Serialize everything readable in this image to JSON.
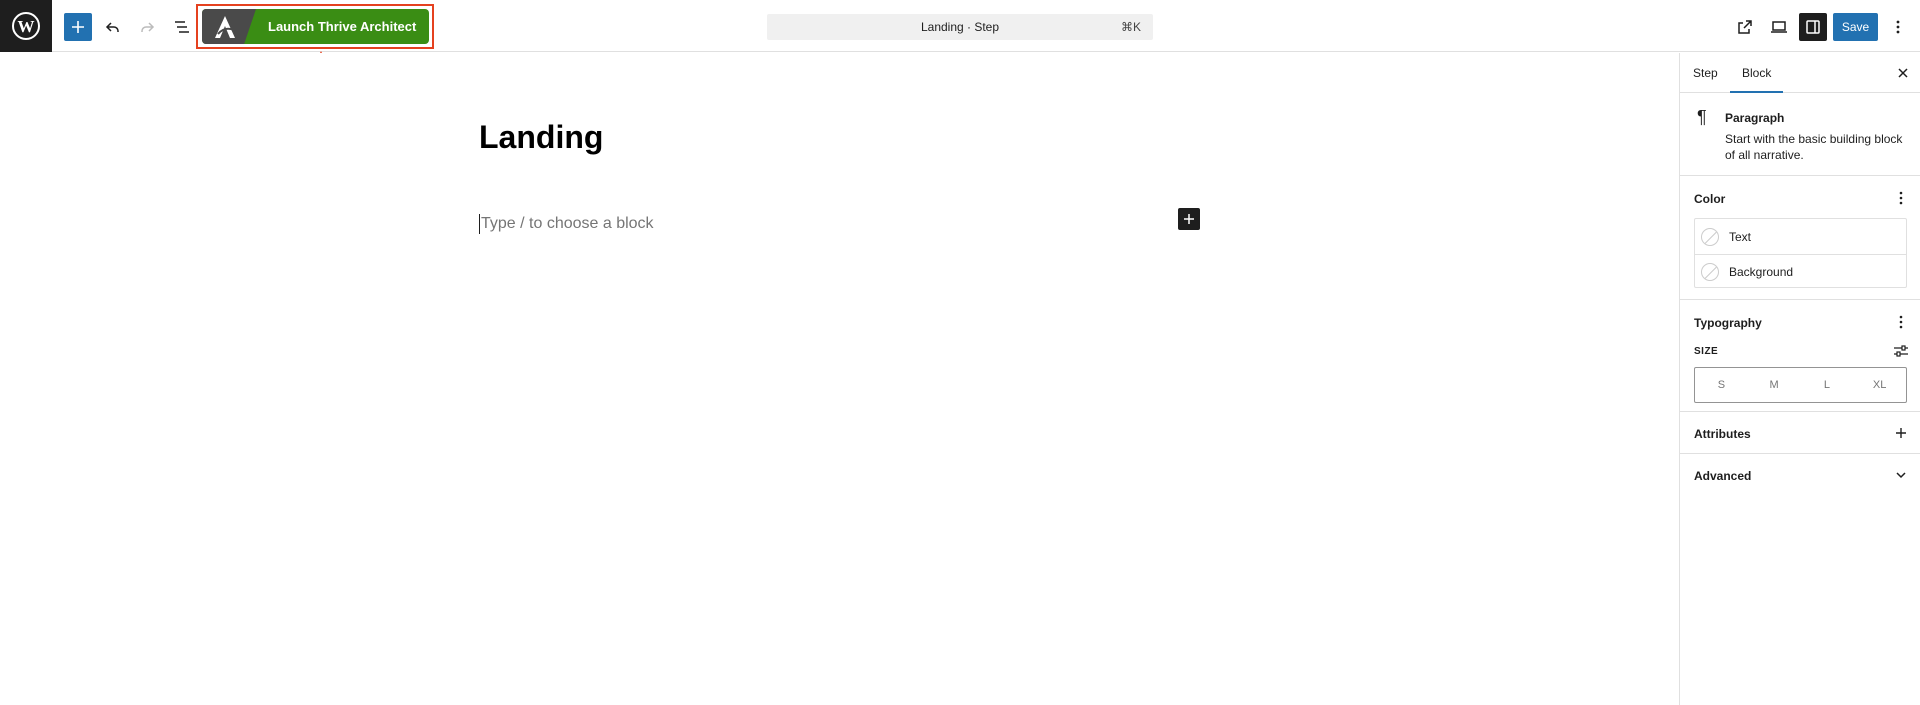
{
  "toolbar": {
    "thrive_button_label": "Launch Thrive Architect",
    "document_title": "Landing · Step",
    "document_shortcut": "⌘K",
    "save_label": "Save"
  },
  "editor": {
    "post_title": "Landing",
    "block_placeholder": "Type / to choose a block"
  },
  "sidebar": {
    "tabs": [
      {
        "label": "Step"
      },
      {
        "label": "Block"
      }
    ],
    "active_tab": "Block",
    "block_card": {
      "name": "Paragraph",
      "description": "Start with the basic building block of all narrative."
    },
    "color": {
      "title": "Color",
      "items": [
        {
          "label": "Text"
        },
        {
          "label": "Background"
        }
      ]
    },
    "typography": {
      "title": "Typography",
      "size_label": "SIZE",
      "sizes": [
        "S",
        "M",
        "L",
        "XL"
      ]
    },
    "attributes": {
      "title": "Attributes"
    },
    "advanced": {
      "title": "Advanced"
    }
  },
  "colors": {
    "wp_blue": "#2271b1",
    "thrive_green": "#3a8d14",
    "highlight_red": "#e5411f",
    "dark": "#1e1e1e"
  }
}
